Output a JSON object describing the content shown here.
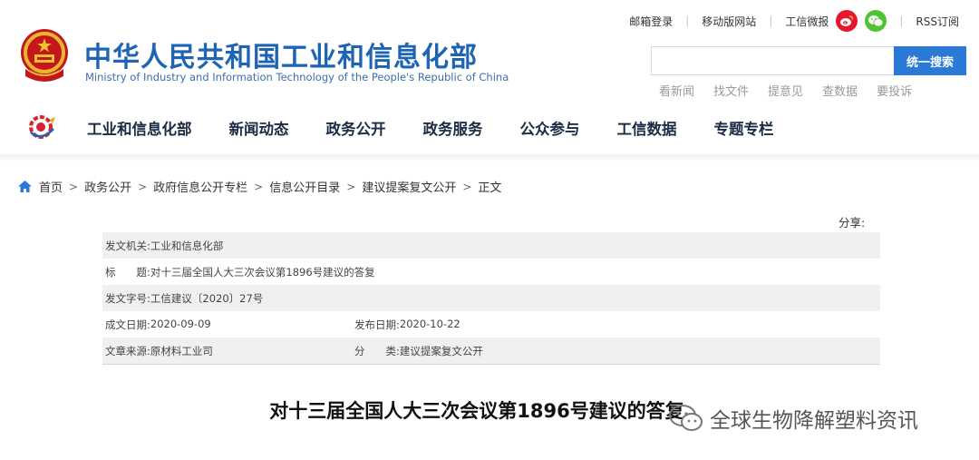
{
  "top_links": {
    "mail": "邮箱登录",
    "mobile": "移动版网站",
    "weibo": "工信微报",
    "rss": "RSS订阅",
    "weibo_icon": "weibo-icon",
    "wechat_icon": "wechat-icon"
  },
  "header": {
    "title": "中华人民共和国工业和信息化部",
    "subtitle": "Ministry of Industry and Information Technology of the People's Republic of China"
  },
  "search": {
    "placeholder": "",
    "button": "统一搜索",
    "quick_links": [
      "看新闻",
      "找文件",
      "提意见",
      "查数据",
      "要投诉"
    ]
  },
  "nav": {
    "items": [
      "工业和信息化部",
      "新闻动态",
      "政务公开",
      "政务服务",
      "公众参与",
      "工信数据",
      "专题专栏"
    ]
  },
  "breadcrumb": {
    "items": [
      "首页",
      "政务公开",
      "政府信息公开专栏",
      "信息公开目录",
      "建议提案复文公开",
      "正文"
    ]
  },
  "share": {
    "label": "分享:"
  },
  "meta": {
    "issuer_key": "发文机关:",
    "issuer": "工业和信息化部",
    "title_key": "标　　题:",
    "title": "对十三届全国人大三次会议第1896号建议的答复",
    "doc_no_key": "发文字号:",
    "doc_no": "工信建议〔2020〕27号",
    "created_key": "成文日期:",
    "created": "2020-09-09",
    "published_key": "发布日期:",
    "published": "2020-10-22",
    "source_key": "文章来源:",
    "source": "原材料工业司",
    "category_key": "分　　类:",
    "category": "建议提案复文公开"
  },
  "article": {
    "title": "对十三届全国人大三次会议第1896号建议的答复"
  },
  "watermark": {
    "text": "全球生物降解塑料资讯"
  },
  "colors": {
    "brand_blue": "#1d64b4",
    "search_button": "#2a79d6",
    "weibo": "#e6162d",
    "wechat": "#51c332",
    "shaded_row": "#eef0f2"
  }
}
